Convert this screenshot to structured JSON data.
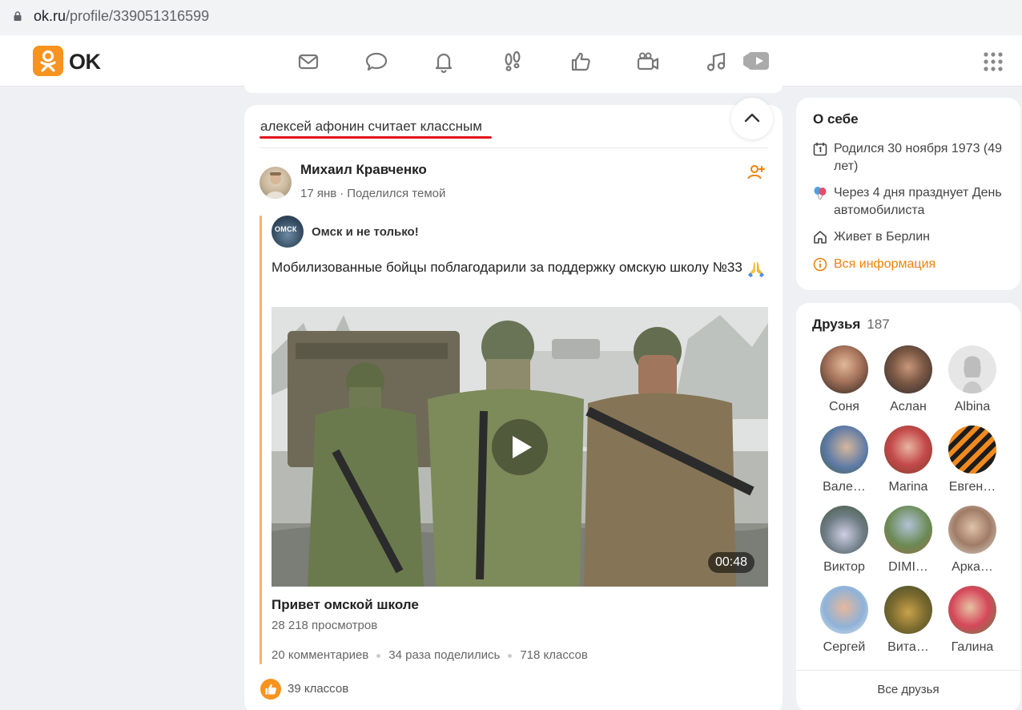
{
  "browser": {
    "url_host": "ok.ru",
    "url_path": "/profile/339051316599"
  },
  "nav": {
    "logo_text": "OK",
    "icons": [
      "mail-icon",
      "chat-icon",
      "bell-icon",
      "footprints-icon",
      "like-icon",
      "video-camera-icon",
      "music-icon",
      "video-play-icon"
    ]
  },
  "feed": {
    "header": "алексей афонин считает классным",
    "author": {
      "name": "Михаил Кравченко",
      "date": "17 янв",
      "action": "Поделился темой"
    },
    "group": {
      "name": "Омск и не только!",
      "avatar_text": "ОМСК"
    },
    "post_text": "Мобилизованные бойцы поблагодарили за поддержку омскую школу №33",
    "video": {
      "duration": "00:48",
      "title": "Привет омской школе",
      "views": "28 218 просмотров"
    },
    "stats": {
      "comments": "20 комментариев",
      "shares": "34 раза поделились",
      "classes": "718 классов"
    },
    "likes": "39 классов"
  },
  "about": {
    "title": "О себе",
    "born": "Родился 30 ноября 1973 (49 лет)",
    "holiday": "Через 4 дня празднует День автомобилиста",
    "lives": "Живет в Берлин",
    "all_info": "Вся информация"
  },
  "friends": {
    "title": "Друзья",
    "count": "187",
    "items": [
      {
        "name": "Соня"
      },
      {
        "name": "Аслан"
      },
      {
        "name": "Albina"
      },
      {
        "name": "Вале…"
      },
      {
        "name": "Marina"
      },
      {
        "name": "Евген…"
      },
      {
        "name": "Виктор"
      },
      {
        "name": "DIMI…"
      },
      {
        "name": "Арка…"
      },
      {
        "name": "Сергей"
      },
      {
        "name": "Вита…"
      },
      {
        "name": "Галина"
      }
    ],
    "all_label": "Все друзья"
  },
  "colors": {
    "accent": "#f7931e",
    "link": "#ee8208",
    "underline": "#e3141f",
    "background": "#eef0f3"
  }
}
